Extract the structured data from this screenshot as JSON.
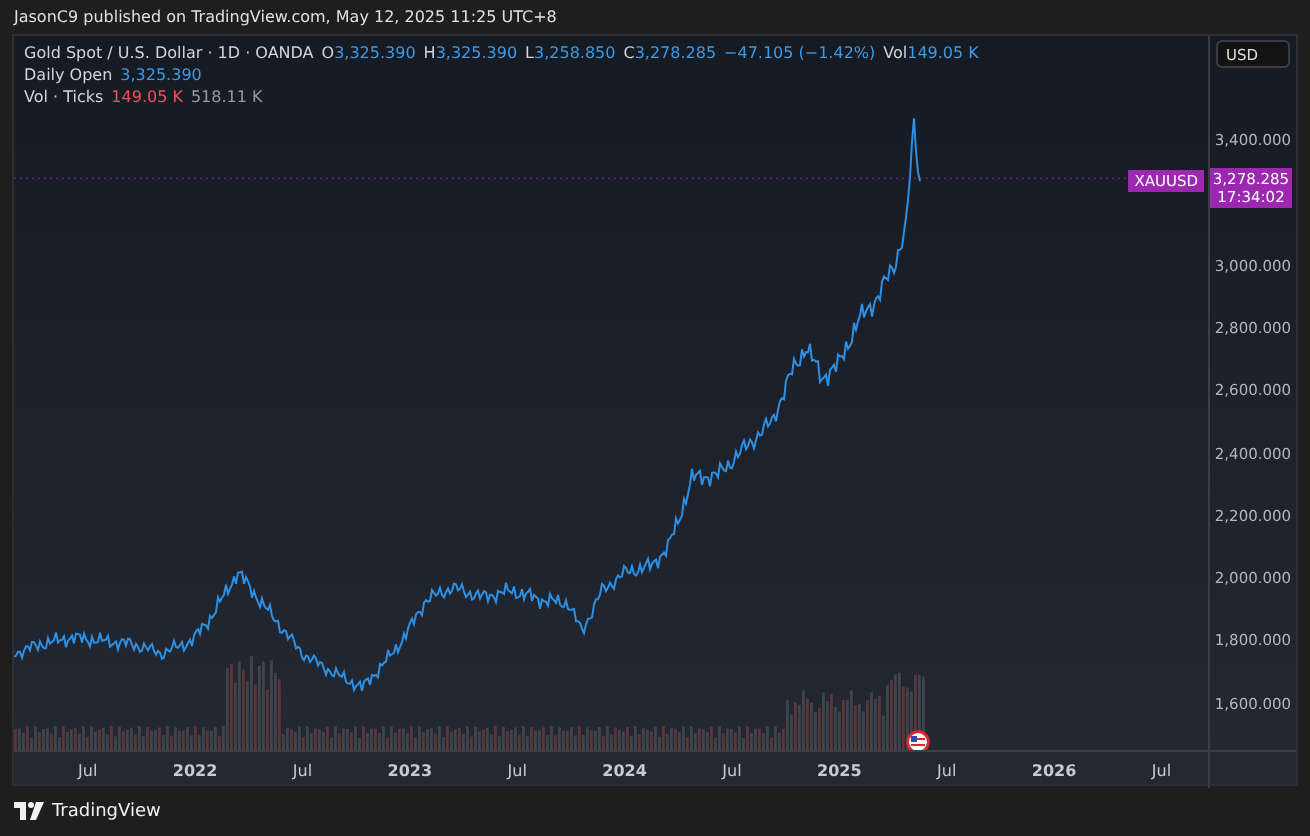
{
  "header": {
    "text": "JasonC9 published on TradingView.com, May 12, 2025 11:25 UTC+8"
  },
  "legend": {
    "symbol": "Gold Spot / U.S. Dollar · 1D · OANDA",
    "ohlc": [
      {
        "label": "O",
        "value": "3,325.390"
      },
      {
        "label": "H",
        "value": "3,325.390"
      },
      {
        "label": "L",
        "value": "3,258.850"
      },
      {
        "label": "C",
        "value": "3,278.285"
      }
    ],
    "change": "−47.105 (−1.42%)",
    "vol_label": "Vol",
    "vol_value": "149.05 K",
    "daily_open": {
      "label": "Daily Open",
      "value": "3,325.390"
    },
    "vol_ticks": {
      "label": "Vol · Ticks",
      "down_value": "149.05 K",
      "total_value": "518.11 K"
    }
  },
  "price_axis": {
    "currency": "USD",
    "ticks": [
      "3,400.000",
      "3,000.000",
      "2,800.000",
      "2,600.000",
      "2,400.000",
      "2,200.000",
      "2,000.000",
      "1,800.000",
      "1,600.000"
    ],
    "symbol_tag": "XAUUSD",
    "last_price": "3,278.285",
    "countdown": "17:34:02"
  },
  "time_axis": {
    "ticks": [
      {
        "label": "Jul",
        "kind": "month"
      },
      {
        "label": "2022",
        "kind": "year"
      },
      {
        "label": "Jul",
        "kind": "month"
      },
      {
        "label": "2023",
        "kind": "year"
      },
      {
        "label": "Jul",
        "kind": "month"
      },
      {
        "label": "2024",
        "kind": "year"
      },
      {
        "label": "Jul",
        "kind": "month"
      },
      {
        "label": "2025",
        "kind": "year"
      },
      {
        "label": "Jul",
        "kind": "month"
      },
      {
        "label": "2026",
        "kind": "year"
      },
      {
        "label": "Jul",
        "kind": "month"
      }
    ]
  },
  "footer": {
    "brand": "TradingView"
  }
}
